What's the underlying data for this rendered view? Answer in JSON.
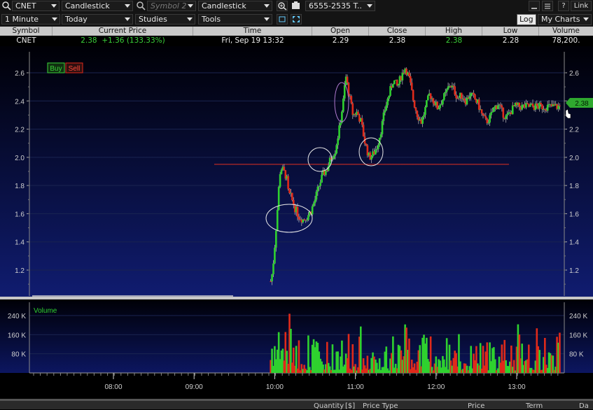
{
  "toolbar1": {
    "symbol": "CNET",
    "chart_type": "Candlestick",
    "symbol2_placeholder": "Symbol 2",
    "chart_type2": "Candlestick",
    "account": "6555-2535 T..",
    "help": "?",
    "link": "Link"
  },
  "toolbar2": {
    "interval": "1 Minute",
    "range": "Today",
    "studies": "Studies",
    "tools": "Tools",
    "log": "Log",
    "my_charts": "My Charts"
  },
  "quote": {
    "headers": [
      "Symbol",
      "Current Price",
      "Time",
      "Open",
      "Close",
      "High",
      "Low",
      "Volume"
    ],
    "symbol": "CNET",
    "current_price": "2.38",
    "change": "+1.36 (133.33%)",
    "time": "Fri, Sep 19  13:32",
    "open": "2.29",
    "close": "2.38",
    "high": "2.38",
    "low": "2.28",
    "volume": "78,200."
  },
  "trade_buttons": {
    "buy": "Buy",
    "sell": "Sell"
  },
  "price_tag": "2.38",
  "volume_label": "Volume",
  "bottom_bar": [
    "Quantity",
    "[$]",
    "Price Type",
    "Price",
    "Term",
    "Da"
  ],
  "colors": {
    "up": "#2fd12f",
    "down": "#e02a1a",
    "wick": "#aaaaaa",
    "support": "#e03020",
    "bg_top": "#000008",
    "bg_bottom": "#0f1a6a"
  },
  "chart_data": {
    "type": "candlestick",
    "price_ticks": [
      "1.2",
      "1.4",
      "1.6",
      "1.8",
      "2.0",
      "2.2",
      "2.4",
      "2.6"
    ],
    "volume_ticks": [
      "80 K",
      "160 K",
      "240 K"
    ],
    "time_ticks": [
      "08:00",
      "09:00",
      "10:00",
      "11:00",
      "12:00",
      "13:00"
    ],
    "ylim": [
      1.05,
      2.7
    ],
    "support_line": 1.95,
    "last_price": 2.38,
    "price_path": [
      [
        9.95,
        1.12
      ],
      [
        9.97,
        1.18
      ],
      [
        9.99,
        1.3
      ],
      [
        10.01,
        1.45
      ],
      [
        10.03,
        1.6
      ],
      [
        10.05,
        1.78
      ],
      [
        10.07,
        1.92
      ],
      [
        10.09,
        1.92
      ],
      [
        10.11,
        1.9
      ],
      [
        10.13,
        1.88
      ],
      [
        10.15,
        1.84
      ],
      [
        10.17,
        1.74
      ],
      [
        10.2,
        1.72
      ],
      [
        10.25,
        1.64
      ],
      [
        10.3,
        1.58
      ],
      [
        10.35,
        1.56
      ],
      [
        10.4,
        1.58
      ],
      [
        10.45,
        1.62
      ],
      [
        10.5,
        1.7
      ],
      [
        10.55,
        1.8
      ],
      [
        10.6,
        1.88
      ],
      [
        10.65,
        1.92
      ],
      [
        10.7,
        2.0
      ],
      [
        10.75,
        2.05
      ],
      [
        10.8,
        2.2
      ],
      [
        10.85,
        2.4
      ],
      [
        10.88,
        2.58
      ],
      [
        10.92,
        2.45
      ],
      [
        10.97,
        2.3
      ],
      [
        11.02,
        2.32
      ],
      [
        11.07,
        2.25
      ],
      [
        11.12,
        2.1
      ],
      [
        11.17,
        2.0
      ],
      [
        11.22,
        2.02
      ],
      [
        11.27,
        2.08
      ],
      [
        11.32,
        2.2
      ],
      [
        11.37,
        2.35
      ],
      [
        11.42,
        2.45
      ],
      [
        11.47,
        2.55
      ],
      [
        11.52,
        2.5
      ],
      [
        11.57,
        2.58
      ],
      [
        11.62,
        2.64
      ],
      [
        11.67,
        2.55
      ],
      [
        11.72,
        2.4
      ],
      [
        11.77,
        2.3
      ],
      [
        11.82,
        2.25
      ],
      [
        11.87,
        2.35
      ],
      [
        11.92,
        2.45
      ],
      [
        11.97,
        2.4
      ],
      [
        12.02,
        2.35
      ],
      [
        12.07,
        2.4
      ],
      [
        12.12,
        2.45
      ],
      [
        12.17,
        2.52
      ],
      [
        12.22,
        2.48
      ],
      [
        12.27,
        2.42
      ],
      [
        12.32,
        2.44
      ],
      [
        12.37,
        2.4
      ],
      [
        12.42,
        2.45
      ],
      [
        12.47,
        2.42
      ],
      [
        12.52,
        2.38
      ],
      [
        12.57,
        2.3
      ],
      [
        12.62,
        2.25
      ],
      [
        12.67,
        2.28
      ],
      [
        12.72,
        2.35
      ],
      [
        12.77,
        2.38
      ],
      [
        12.82,
        2.32
      ],
      [
        12.87,
        2.28
      ],
      [
        12.92,
        2.32
      ],
      [
        12.97,
        2.36
      ]
    ]
  }
}
